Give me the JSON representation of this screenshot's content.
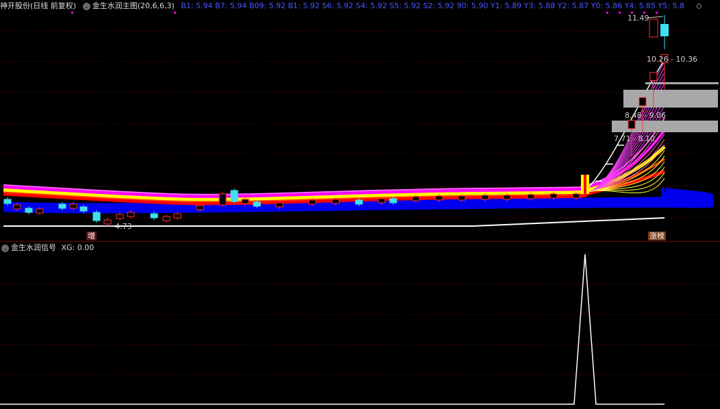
{
  "header": {
    "stock_title": "神开股份(日线 前复权)",
    "indicator_name": "金生水润主图(20,6,6,3)",
    "readout": "B1: 5.94 B7: 5.94 B09: 5.92 B1: 5.92 S6: 5.92 S4: 5.92 S5: 5.92 S2: 5.92 90: 5.90 Y1: 5.89 Y3: 5.88 Y2: 5.87 Y0: 5.86 Y4: 5.85 Y5: 5.8",
    "diamond": "◇"
  },
  "main_chart": {
    "price_labels": {
      "high": "11.49",
      "zone1": "10.26 - 10.36",
      "zone2": "8.48 - 9.06",
      "zone3": "7.71 - 8.10",
      "low": "4.73"
    },
    "tags": {
      "left": "增",
      "right": "涨榜"
    }
  },
  "signal_panel": {
    "title": "金生水润信号",
    "readout": "XG: 0.00"
  },
  "colors": {
    "up": "#ff3030",
    "down": "#40e0f0",
    "band_blue": "#0000ee",
    "band_magenta": "#ff00ff",
    "band_yellow": "#ffff00",
    "grid": "#6e0000"
  },
  "chart_data": [
    {
      "type": "candlestick",
      "name": "金生水润主图",
      "title": "金生水润主图(20,6,6,3)",
      "closes_recent": [
        5.94,
        6.53,
        7.18,
        7.9,
        8.69,
        9.56,
        10.52,
        11.2
      ],
      "price_marks": {
        "high": 11.49,
        "low": 4.73
      },
      "zones": [
        [
          10.26,
          10.36
        ],
        [
          8.48,
          9.06
        ],
        [
          7.71,
          8.1
        ]
      ]
    },
    {
      "type": "line",
      "name": "XG",
      "title": "金生水润信号",
      "y_current": 0.0,
      "signal_index_from_end": 6
    }
  ]
}
